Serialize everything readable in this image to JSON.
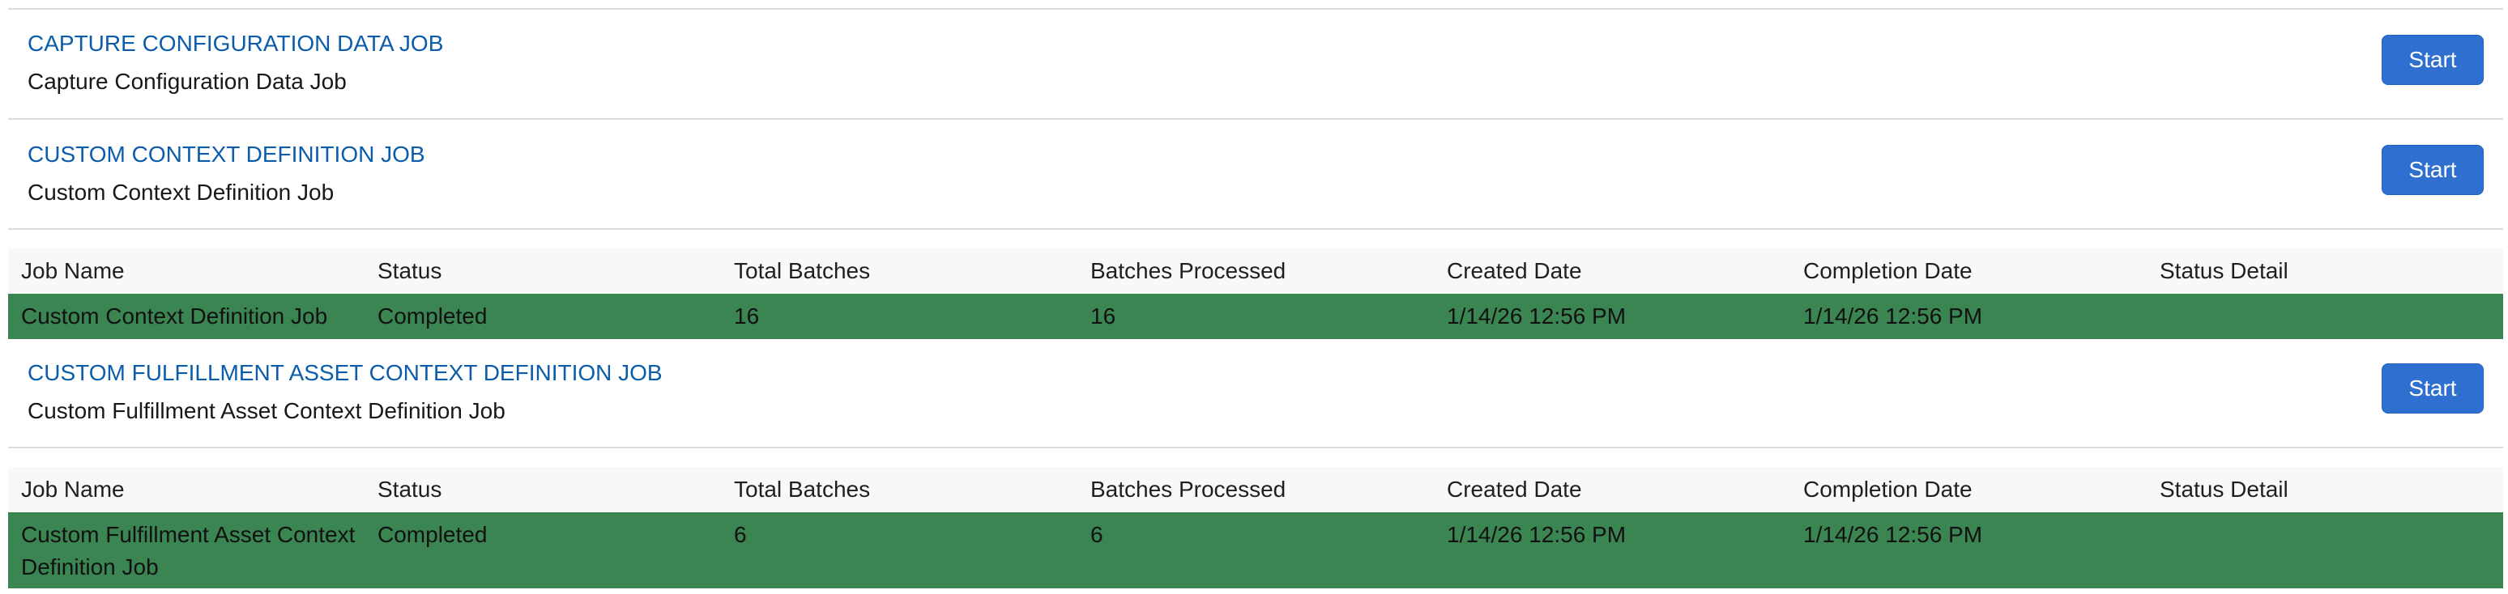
{
  "jobs": [
    {
      "title": "CAPTURE CONFIGURATION DATA JOB",
      "description": "Capture Configuration Data Job",
      "start_label": "Start"
    },
    {
      "title": "CUSTOM CONTEXT DEFINITION JOB",
      "description": "Custom Context Definition Job",
      "start_label": "Start",
      "table": {
        "columns": [
          "Job Name",
          "Status",
          "Total Batches",
          "Batches Processed",
          "Created Date",
          "Completion Date",
          "Status Detail"
        ],
        "rows": [
          {
            "job_name": "Custom Context Definition Job",
            "status": "Completed",
            "total_batches": "16",
            "batches_processed": "16",
            "created_date": "1/14/26 12:56 PM",
            "completion_date": "1/14/26 12:56 PM",
            "status_detail": ""
          }
        ]
      }
    },
    {
      "title": "CUSTOM FULFILLMENT ASSET CONTEXT DEFINITION JOB",
      "description": "Custom Fulfillment Asset Context Definition Job",
      "start_label": "Start",
      "table": {
        "columns": [
          "Job Name",
          "Status",
          "Total Batches",
          "Batches Processed",
          "Created Date",
          "Completion Date",
          "Status Detail"
        ],
        "rows": [
          {
            "job_name": "Custom Fulfillment Asset Context Definition Job",
            "status": "Completed",
            "total_batches": "6",
            "batches_processed": "6",
            "created_date": "1/14/26 12:56 PM",
            "completion_date": "1/14/26 12:56 PM",
            "status_detail": ""
          }
        ]
      }
    }
  ],
  "colors": {
    "link": "#0b5cab",
    "button": "#2e6fcf",
    "completed_row": "#3b8552",
    "header_bg": "#f8f8f7",
    "divider": "#dddbda"
  }
}
